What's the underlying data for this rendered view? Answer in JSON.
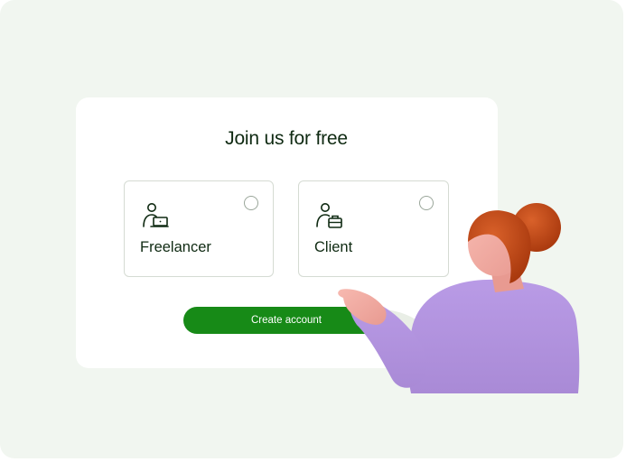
{
  "signup": {
    "title": "Join us for free",
    "options": [
      {
        "label": "Freelancer",
        "icon": "freelancer-laptop-icon",
        "selected": false
      },
      {
        "label": "Client",
        "icon": "client-briefcase-icon",
        "selected": false
      }
    ],
    "cta_label": "Create account"
  },
  "colors": {
    "background": "#f1f6f0",
    "card": "#ffffff",
    "accent": "#178a17",
    "text": "#0f2a12",
    "border": "#d5dbd3"
  }
}
